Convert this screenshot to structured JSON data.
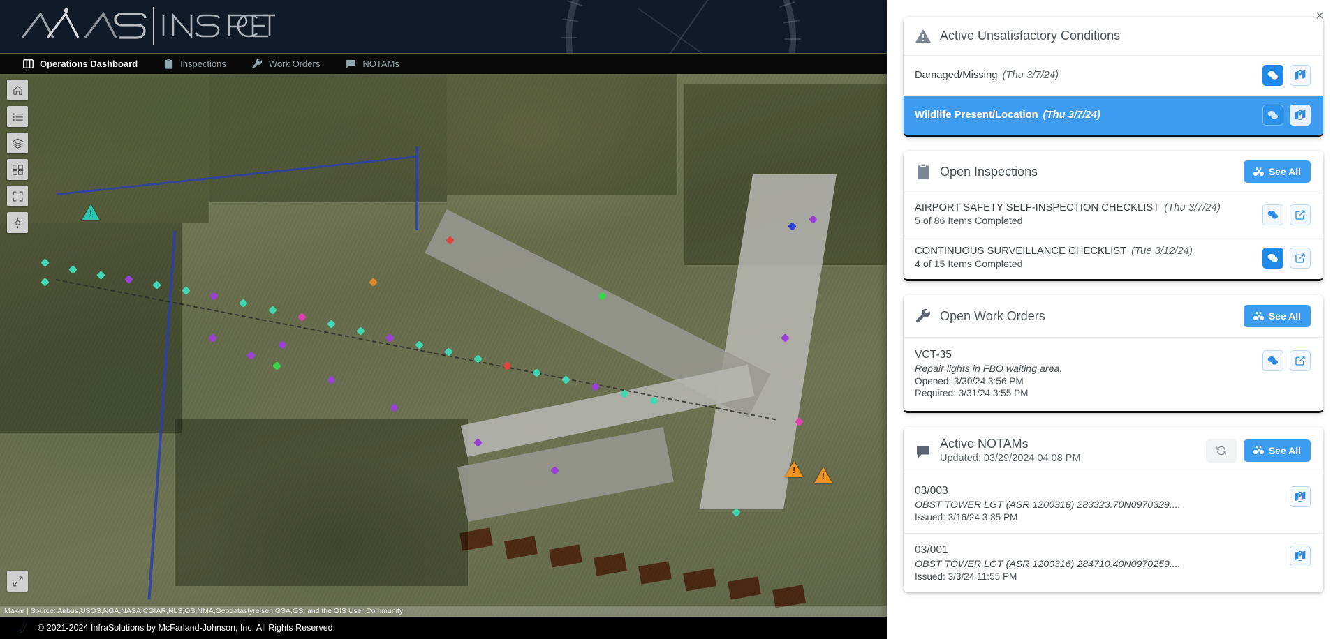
{
  "brand": {
    "mark": "AVAS",
    "product": "INSPECT"
  },
  "nav": {
    "items": [
      {
        "label": "Operations Dashboard",
        "icon": "dashboard-icon",
        "active": true
      },
      {
        "label": "Inspections",
        "icon": "clipboard-icon",
        "active": false
      },
      {
        "label": "Work Orders",
        "icon": "wrench-icon",
        "active": false
      },
      {
        "label": "NOTAMs",
        "icon": "speech-bubble-icon",
        "active": false
      }
    ]
  },
  "map_tools": {
    "items": [
      {
        "icon": "home-icon",
        "name": "home-extent"
      },
      {
        "icon": "legend-list-icon",
        "name": "legend"
      },
      {
        "icon": "layers-icon",
        "name": "layers"
      },
      {
        "icon": "basemap-grid-icon",
        "name": "basemap-gallery"
      },
      {
        "icon": "fullscreen-icon",
        "name": "full-extent"
      },
      {
        "icon": "locate-icon",
        "name": "locate"
      }
    ],
    "bottom": {
      "icon": "expand-panel-icon",
      "name": "expand-map"
    }
  },
  "map": {
    "attribution": "Maxar | Source: Airbus,USGS,NGA,NASA,CGIAR,NLS,OS,NMA,Geodatastyrelsen,GSA,GSI and the GIS User Community"
  },
  "footer": {
    "copyright": "© 2021-2024 InfraSolutions by McFarland-Johnson, Inc. All Rights Reserved."
  },
  "panel": {
    "close_label": "×",
    "unsat": {
      "title": "Active Unsatisfactory Conditions",
      "icon": "warning-triangle-icon",
      "items": [
        {
          "label": "Damaged/Missing",
          "date": "(Thu 3/7/24)",
          "selected": false,
          "actions": [
            {
              "icon": "comments-icon",
              "style": "filled"
            },
            {
              "icon": "map-marker-icon",
              "style": "outline"
            }
          ]
        },
        {
          "label": "Wildlife Present/Location",
          "date": "(Thu 3/7/24)",
          "selected": true,
          "actions": [
            {
              "icon": "comments-icon",
              "style": "onblue"
            },
            {
              "icon": "map-marker-icon",
              "style": "onblue-light"
            }
          ]
        }
      ]
    },
    "inspections": {
      "title": "Open Inspections",
      "icon": "clipboard-icon",
      "see_all": "See All",
      "items": [
        {
          "title": "AIRPORT SAFETY SELF-INSPECTION CHECKLIST",
          "date": "(Thu 3/7/24)",
          "progress": "5 of 86 Items Completed",
          "actions": [
            {
              "icon": "comments-icon",
              "style": "outline"
            },
            {
              "icon": "edit-icon",
              "style": "outline"
            }
          ]
        },
        {
          "title": "CONTINUOUS SURVEILLANCE CHECKLIST",
          "date": "(Tue 3/12/24)",
          "progress": "4 of 15 Items Completed",
          "actions": [
            {
              "icon": "comments-icon",
              "style": "filled"
            },
            {
              "icon": "edit-icon",
              "style": "outline"
            }
          ]
        }
      ]
    },
    "work_orders": {
      "title": "Open Work Orders",
      "icon": "wrench-icon",
      "see_all": "See All",
      "items": [
        {
          "id": "VCT-35",
          "description": "Repair lights in FBO waiting area.",
          "opened": "Opened: 3/30/24 3:56 PM",
          "required": "Required: 3/31/24 3:55 PM",
          "actions": [
            {
              "icon": "comments-icon",
              "style": "outline"
            },
            {
              "icon": "edit-icon",
              "style": "outline"
            }
          ]
        }
      ]
    },
    "notams": {
      "title": "Active NOTAMs",
      "icon": "speech-bubble-icon",
      "updated": "Updated:  03/29/2024 04:08 PM",
      "refresh_icon": "refresh-icon",
      "see_all": "See All",
      "items": [
        {
          "id": "03/003",
          "text": "OBST TOWER LGT (ASR 1200318) 283323.70N0970329....",
          "issued": "Issued: 3/16/24 3:35 PM",
          "actions": [
            {
              "icon": "map-marker-icon",
              "style": "outline"
            }
          ]
        },
        {
          "id": "03/001",
          "text": "OBST TOWER LGT (ASR 1200316) 284710.40N0970259....",
          "issued": "Issued: 3/3/24 11:55 PM",
          "actions": [
            {
              "icon": "map-marker-icon",
              "style": "outline"
            }
          ]
        }
      ]
    }
  },
  "colors": {
    "accent": "#3d9bf0",
    "header_bg": "#101b2a",
    "nav_bg": "#0a0a0a",
    "selected_row": "#3d9bf0"
  }
}
